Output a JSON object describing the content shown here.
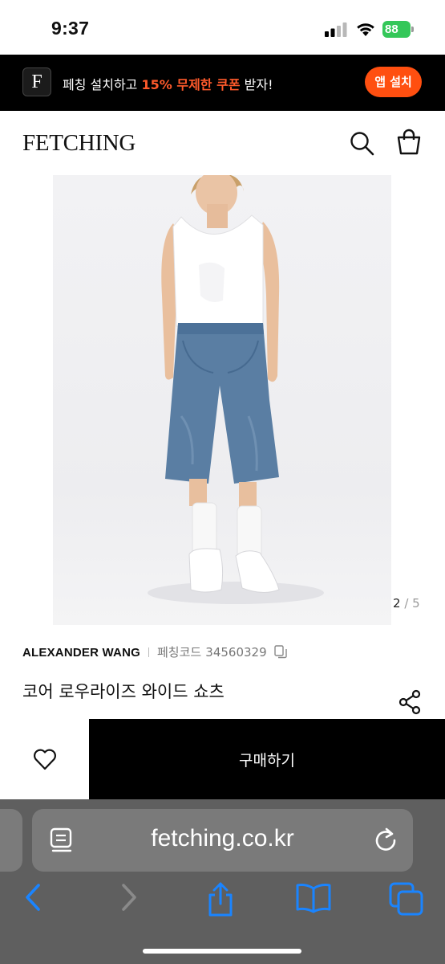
{
  "status_bar": {
    "time": "9:37",
    "battery": "88"
  },
  "promo": {
    "logo_letter": "F",
    "text_before": "페칭 설치하고 ",
    "text_highlight": "15% 무제한 쿠폰",
    "text_after": " 받자!",
    "install_label": "앱 설치",
    "highlight_color": "#ff5a2b",
    "button_color": "#ff4f10"
  },
  "header": {
    "logo": "FETCHING",
    "search_icon": "search-icon",
    "bag_icon": "shopping-bag-icon"
  },
  "gallery": {
    "current": "2",
    "separator": "/",
    "total": "5"
  },
  "product": {
    "brand": "ALEXANDER WANG",
    "code_label": "페칭코드",
    "code": "34560329",
    "title": "코어 로우라이즈 와이드 쇼츠"
  },
  "actions": {
    "wishlist_icon": "heart-icon",
    "buy_label": "구매하기",
    "share_icon": "share-icon"
  },
  "browser": {
    "url": "fetching.co.kr",
    "toolbar": [
      "back-icon",
      "forward-icon",
      "share-icon",
      "bookmarks-icon",
      "tabs-icon"
    ],
    "accent": "#1a84ff"
  }
}
